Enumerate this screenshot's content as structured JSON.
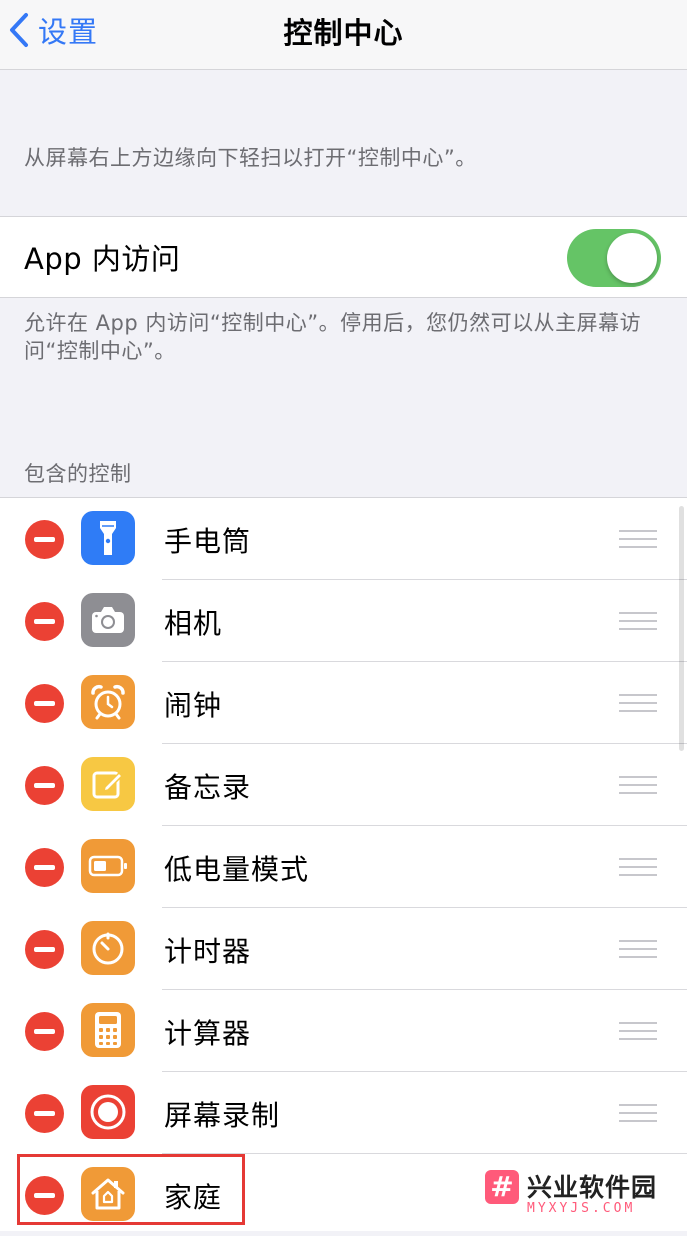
{
  "nav": {
    "back_label": "设置",
    "title": "控制中心"
  },
  "top_description": "从屏幕右上方边缘向下轻扫以打开“控制中心”。",
  "app_access": {
    "label": "App 内访问",
    "enabled": true,
    "description": "允许在 App 内访问“控制中心”。停用后，您仍然可以从主屏幕访问“控制中心”。"
  },
  "included_controls": {
    "header": "包含的控制",
    "items": [
      {
        "label": "手电筒",
        "icon": "flashlight-icon",
        "color": "#2f7cf6"
      },
      {
        "label": "相机",
        "icon": "camera-icon",
        "color": "#8e8e93"
      },
      {
        "label": "闹钟",
        "icon": "alarm-icon",
        "color": "#f09a37"
      },
      {
        "label": "备忘录",
        "icon": "notes-icon",
        "color": "#f7c843"
      },
      {
        "label": "低电量模式",
        "icon": "battery-icon",
        "color": "#f09a37"
      },
      {
        "label": "计时器",
        "icon": "timer-icon",
        "color": "#f09a37"
      },
      {
        "label": "计算器",
        "icon": "calculator-icon",
        "color": "#f09a37"
      },
      {
        "label": "屏幕录制",
        "icon": "screen-record-icon",
        "color": "#eb4134"
      },
      {
        "label": "家庭",
        "icon": "home-icon",
        "color": "#f09a37"
      }
    ]
  },
  "colors": {
    "accent": "#3478f6",
    "toggle_on": "#65c466",
    "delete": "#eb4134",
    "highlight": "#e53935"
  },
  "watermark": {
    "logo": "#",
    "name": "兴业软件园",
    "url": "MYXYJS.COM"
  }
}
